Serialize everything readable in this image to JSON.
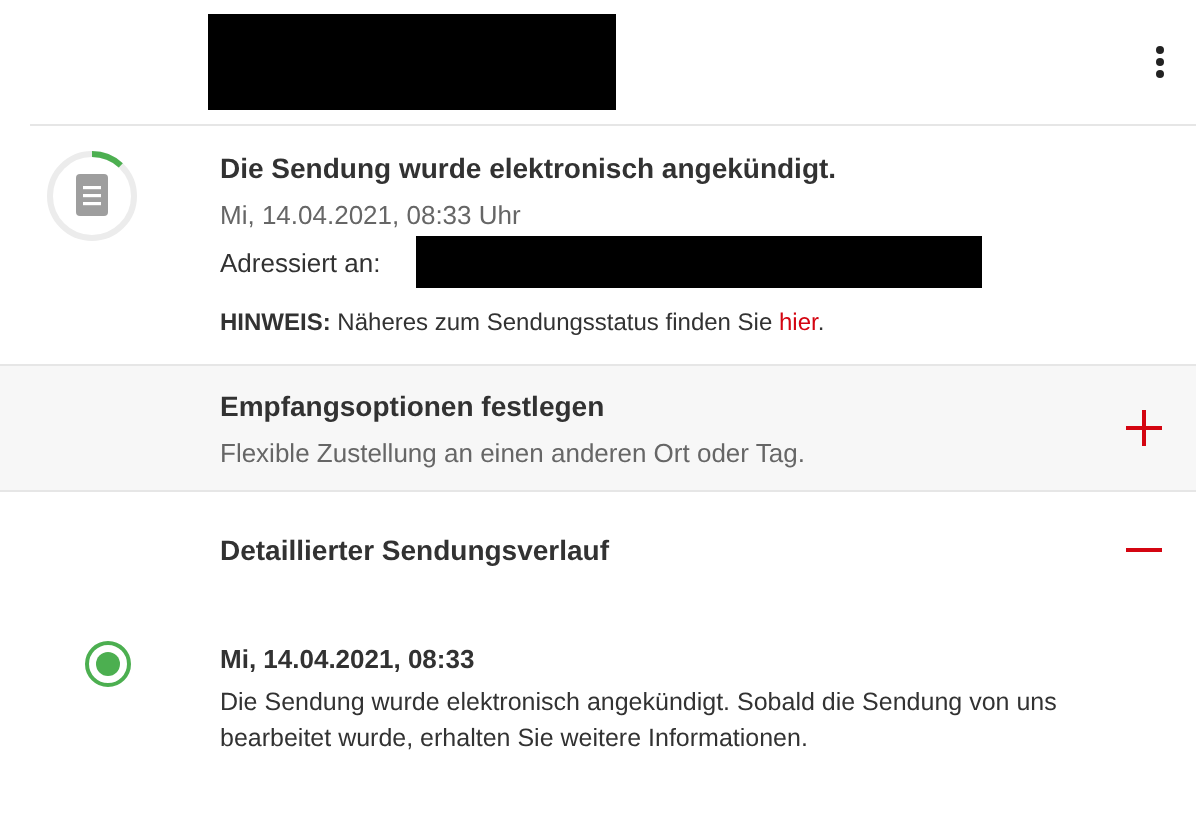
{
  "status": {
    "level": 0.12,
    "title": "Die Sendung wurde elektronisch angekündigt.",
    "date": "Mi, 14.04.2021, 08:33 Uhr",
    "address_label": "Adressiert an:",
    "hint_prefix": "**HINWEIS:** Näheres zum Sendungsstatus finden Sie ",
    "hint_link": "hier",
    "hint_suffix": "."
  },
  "sections": [
    {
      "title": "Empfangsoptionen festlegen",
      "subtitle": "Flexible Zustellung an einen anderen Ort oder Tag.",
      "expanded": false
    },
    {
      "title": "Detaillierter Sendungsverlauf",
      "expanded": true
    }
  ],
  "events": [
    {
      "time": "Mi, 14.04.2021, 08:33",
      "text": "Die Sendung wurde elektronisch angekündigt. Sobald die Sendung von uns bearbeitet wurde, erhalten Sie weitere Informationen."
    }
  ]
}
